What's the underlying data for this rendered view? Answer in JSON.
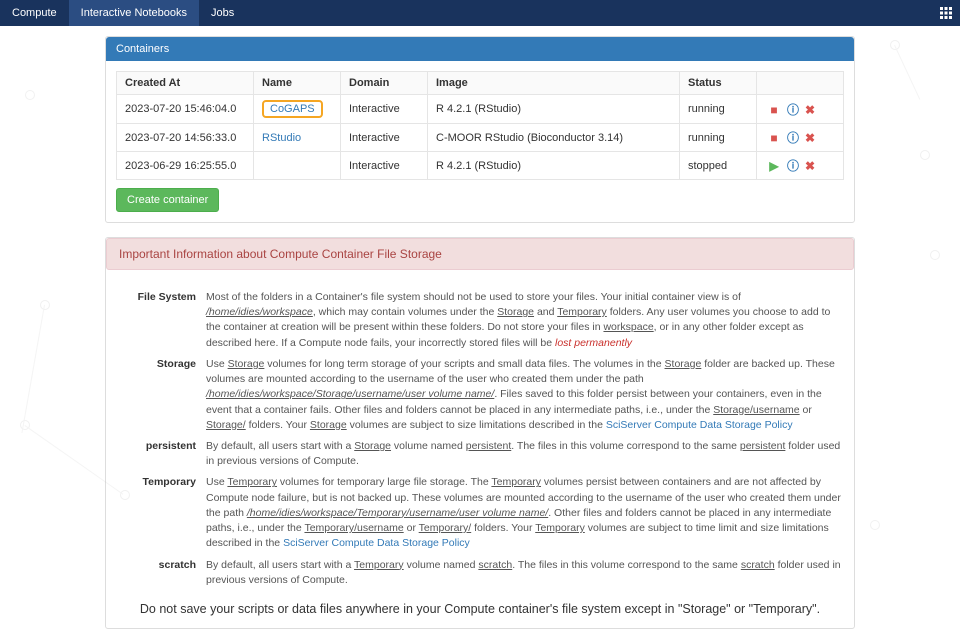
{
  "nav": {
    "compute": "Compute",
    "notebooks": "Interactive Notebooks",
    "jobs": "Jobs"
  },
  "panel_title": "Containers",
  "cols": {
    "created": "Created At",
    "name": "Name",
    "domain": "Domain",
    "image": "Image",
    "status": "Status"
  },
  "rows": [
    {
      "created": "2023-07-20 15:46:04.0",
      "name": "CoGAPS",
      "domain": "Interactive",
      "image": "R 4.2.1 (RStudio)",
      "status": "running",
      "running": true,
      "highlight": true
    },
    {
      "created": "2023-07-20 14:56:33.0",
      "name": "RStudio",
      "domain": "Interactive",
      "image": "C-MOOR RStudio (Bioconductor 3.14)",
      "status": "running",
      "running": true,
      "highlight": false
    },
    {
      "created": "2023-06-29 16:25:55.0",
      "name": "<None>",
      "domain": "Interactive",
      "image": "R 4.2.1 (RStudio)",
      "status": "stopped",
      "running": false,
      "highlight": false
    }
  ],
  "create_btn": "Create container",
  "alert_title": "Important Information about Compute Container File Storage",
  "info": {
    "fs_label": "File System",
    "fs_text_a": "Most of the folders in a Container's file system should not be used to store your files. Your initial container view is of ",
    "fs_path": "/home/idies/workspace",
    "fs_text_b": ", which may contain volumes under the ",
    "storage_u": "Storage",
    "and": " and ",
    "temporary_u": "Temporary",
    "fs_text_c": " folders. Any user volumes you choose to add to the container at creation will be present within these folders. Do not store your files in ",
    "workspace_u": "workspace",
    "fs_text_d": ", or in any other folder except as described here. If a Compute node fails, your incorrectly stored files will be ",
    "lost": "lost permanently",
    ".": ".",
    "storage_label": "Storage",
    "st_a": "Use ",
    "st_b": " volumes for long term storage of your scripts and small data files. The volumes in the ",
    "st_c": " folder are backed up. These volumes are mounted according to the username of the user who created them under the path ",
    "st_path": "/home/idies/workspace/Storage/username/user volume name/",
    "st_d": ". Files saved to this folder persist between your containers, even in the event that a container fails. Other files and folders cannot be placed in any intermediate paths, i.e., under the ",
    "st_path2": "Storage/username",
    "or": " or ",
    "st_path3": "Storage/",
    "st_e": " folders. Your ",
    "st_f": " volumes are subject to size limitations described in the ",
    "policy": "SciServer Compute Data Storage Policy",
    "persist_label": "persistent",
    "pe_a": "By default, all users start with a ",
    "pe_b": " volume named ",
    "persist_u": "persistent",
    "pe_c": ". The files in this volume correspond to the same ",
    "pe_d": " folder used in previous versions of Compute.",
    "temp_label": "Temporary",
    "te_a": "Use ",
    "te_b": " volumes for temporary large file storage. The ",
    "te_c": " volumes persist between containers and are not affected by Compute node failure, but is not backed up. These volumes are mounted according to the username of the user who created them under the path ",
    "te_path": "/home/idies/workspace/Temporary/username/user volume name/",
    "te_d": ". Other files and folders cannot be placed in any intermediate paths, i.e., under the ",
    "te_path2": "Temporary/username",
    "te_path3": "Temporary/",
    "te_e": " folders. Your ",
    "te_f": " volumes are subject to time limit and size limitations described in the ",
    "scratch_label": "scratch",
    "sc_a": "By default, all users start with a ",
    "sc_b": " volume named ",
    "scratch_u": "scratch",
    "sc_c": ". The files in this volume correspond to the same ",
    "sc_d": " folder used in previous versions of Compute."
  },
  "final": "Do not save your scripts or data files anywhere in your Compute container's file system except in \"Storage\" or \"Temporary\"."
}
